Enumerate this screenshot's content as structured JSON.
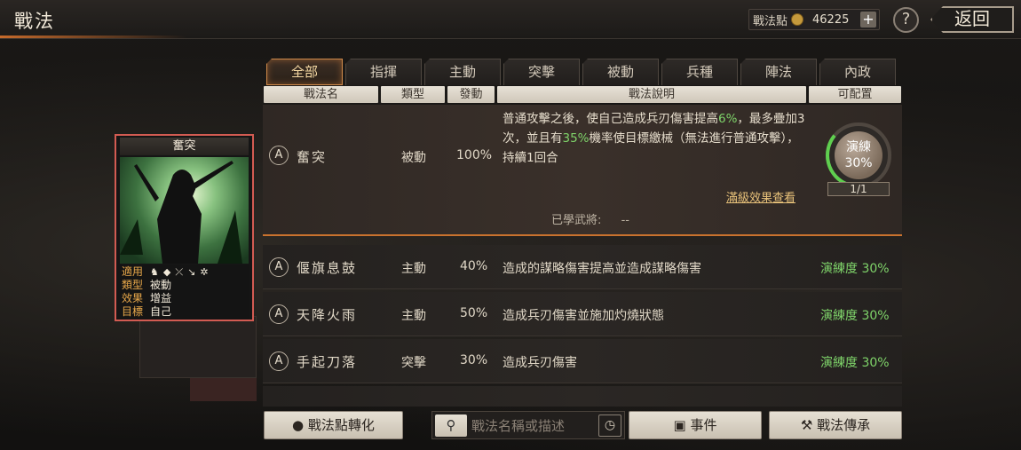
{
  "header": {
    "title": "戰法",
    "points_label": "戰法點",
    "points_value": "46225",
    "plus": "+",
    "help": "?",
    "back": "返回"
  },
  "tabs": [
    "全部",
    "指揮",
    "主動",
    "突擊",
    "被動",
    "兵種",
    "陣法",
    "內政"
  ],
  "columns": {
    "name": "戰法名",
    "type": "類型",
    "trigger": "發動",
    "desc": "戰法說明",
    "assignable": "可配置"
  },
  "selected": {
    "grade": "A",
    "name": "奮突",
    "type": "被動",
    "rate": "100%",
    "desc_parts": [
      "普通攻擊之後，使自己造成兵刃傷害提高",
      "6%",
      "，最多疊加3次，並且有",
      "35%",
      "機率使目標繳械（無法進行普通攻擊），持續1回合"
    ],
    "full_effect_link": "滿級效果查看",
    "learned_label": "已學武將:",
    "learned_value": "--",
    "train_label": "演練",
    "train_value": "30%",
    "train_progress": 0.3,
    "count": "1/1"
  },
  "rows": [
    {
      "grade": "A",
      "name": "偃旗息鼓",
      "type": "主動",
      "rate": "40%",
      "desc": "造成的謀略傷害提高並造成謀略傷害",
      "status": "演練度 30%"
    },
    {
      "grade": "A",
      "name": "天降火雨",
      "type": "主動",
      "rate": "50%",
      "desc": "造成兵刃傷害並施加灼燒狀態",
      "status": "演練度 30%"
    },
    {
      "grade": "A",
      "name": "手起刀落",
      "type": "突擊",
      "rate": "30%",
      "desc": "造成兵刃傷害",
      "status": "演練度 30%"
    }
  ],
  "card": {
    "title": "奮突",
    "use_label": "適用",
    "type_label": "類型",
    "type_value": "被動",
    "effect_label": "效果",
    "effect_value": "增益",
    "target_label": "目標",
    "target_value": "自己",
    "unit_icons": [
      "cavalry-icon",
      "shield-icon",
      "bow-icon",
      "spear-icon",
      "wheel-icon"
    ]
  },
  "bottom": {
    "convert_button": "戰法點轉化",
    "search_placeholder": "戰法名稱或描述",
    "event_button": "事件",
    "inherit_button": "戰法傳承"
  },
  "colors": {
    "accent": "#c9722e",
    "highlight_green": "#7fd46a",
    "card_border": "#d25b52"
  }
}
